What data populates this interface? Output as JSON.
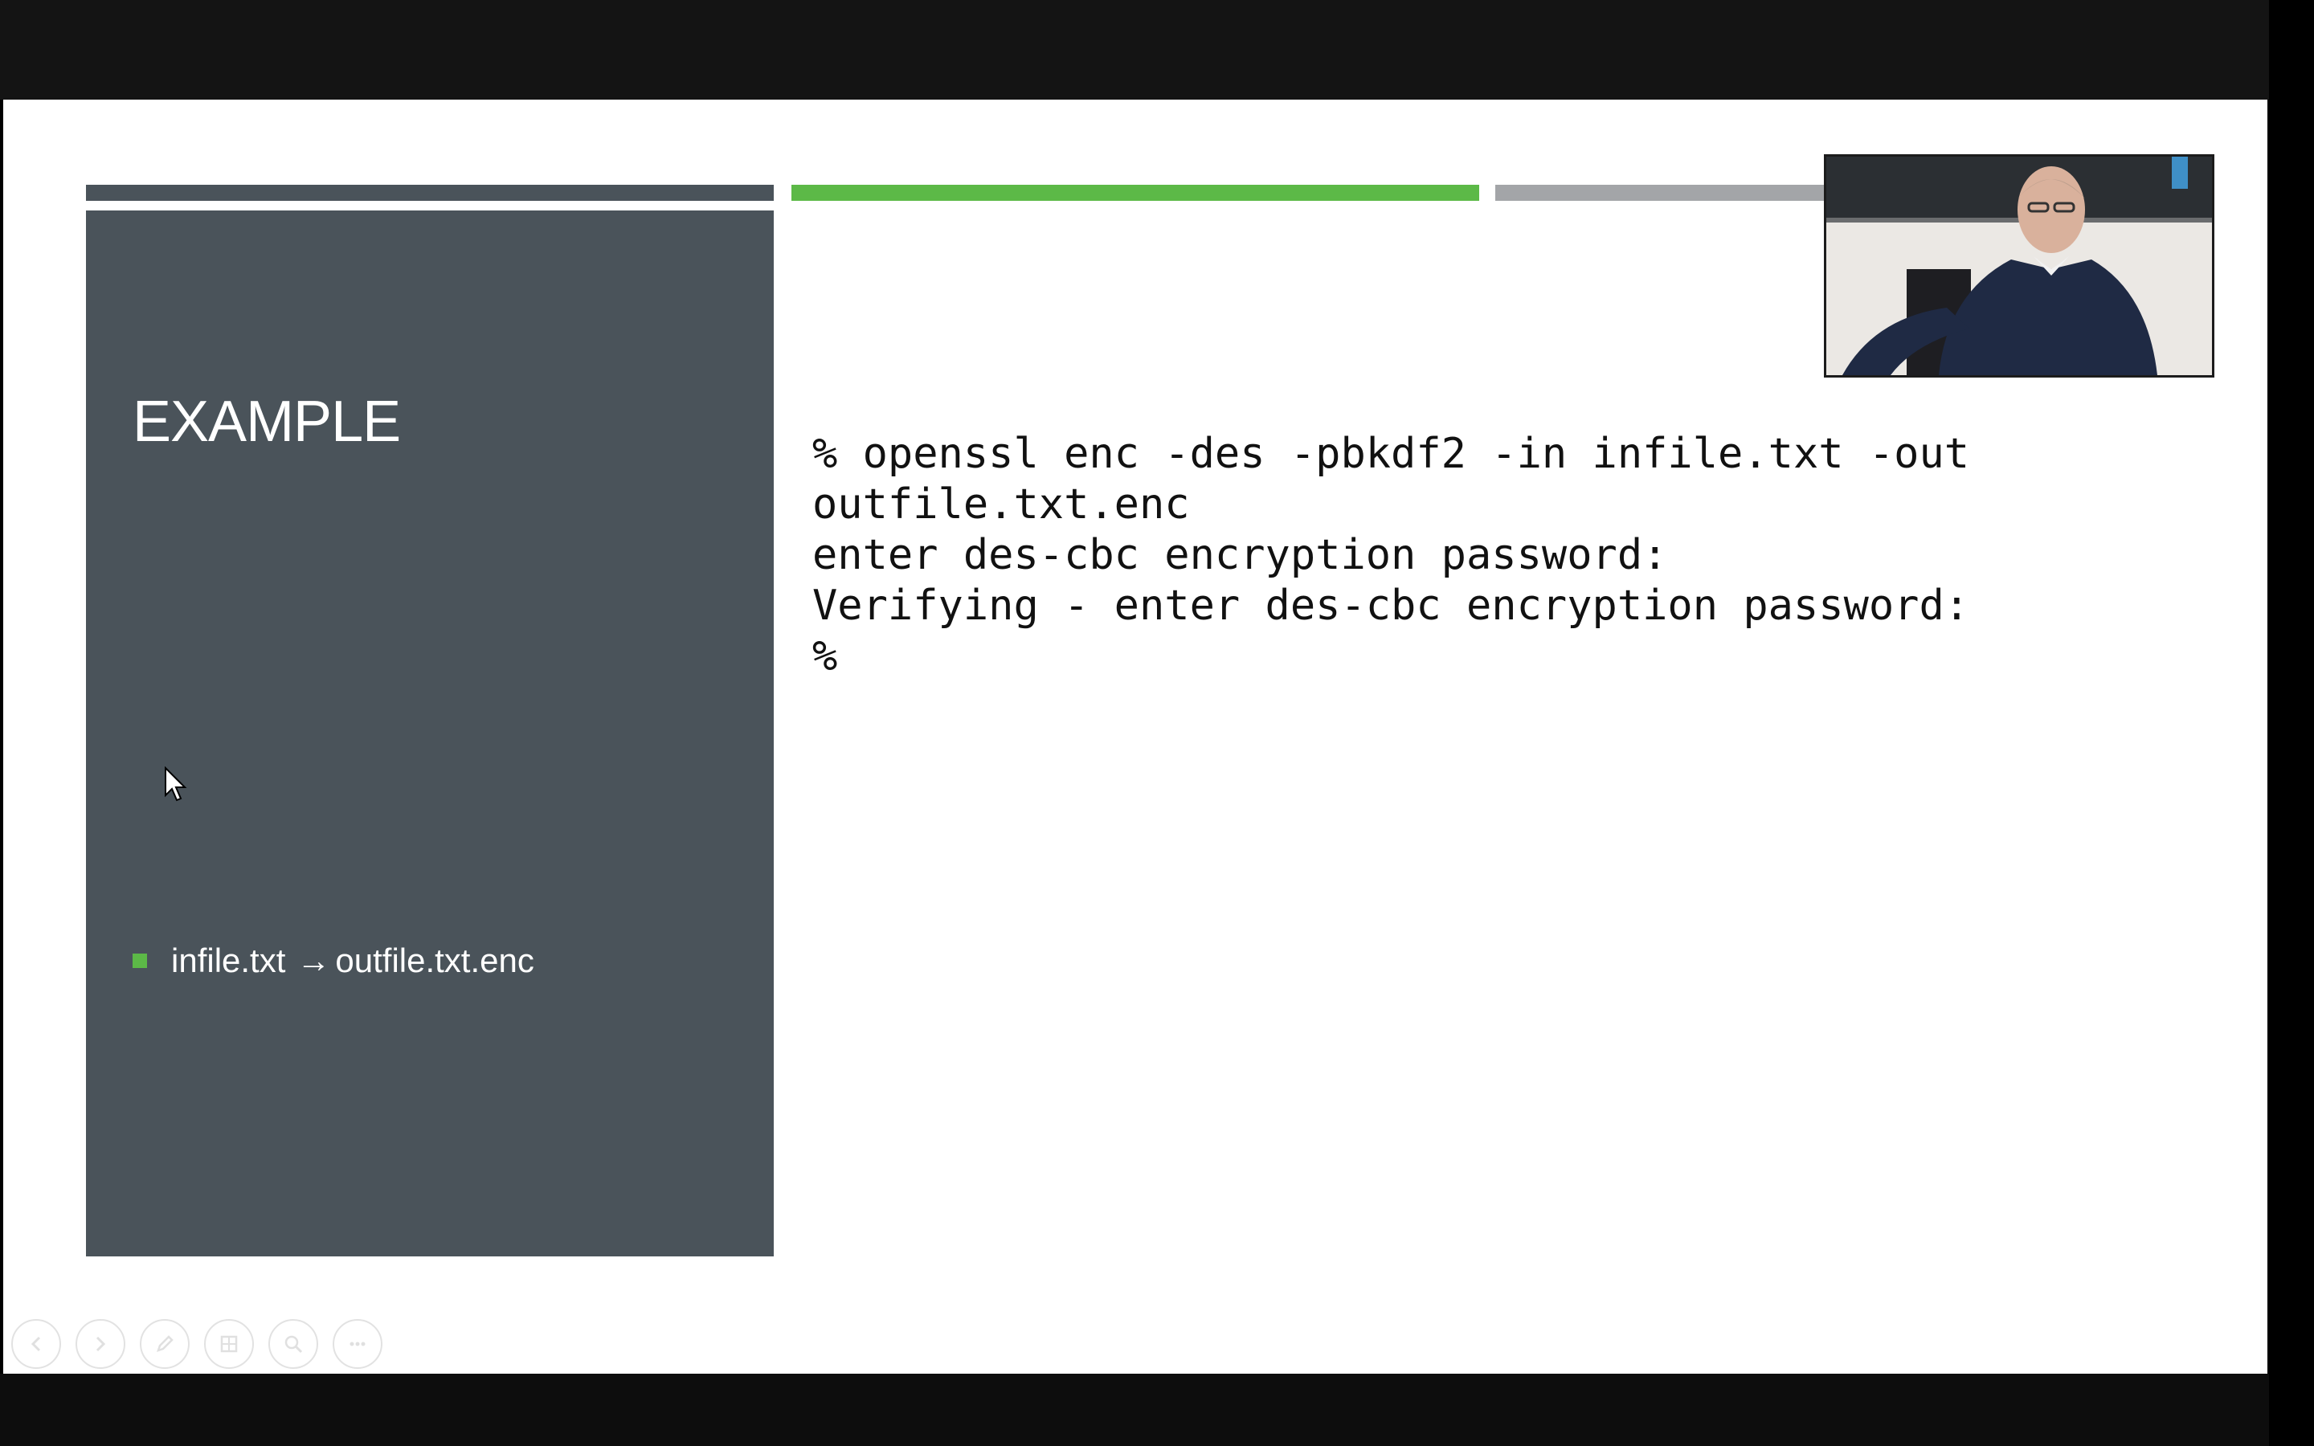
{
  "slide": {
    "title": "EXAMPLE",
    "bullet": {
      "left_text": "infile.txt",
      "arrow": "→",
      "right_text": "outfile.txt.enc"
    },
    "code_lines": [
      "% openssl enc -des -pbkdf2 -in infile.txt -out",
      "outfile.txt.enc",
      "enter des-cbc encryption password:",
      "Verifying - enter des-cbc encryption password:",
      "%"
    ]
  },
  "toolbar": {
    "buttons": [
      {
        "name": "previous-slide-button",
        "icon": "arrow-left-icon"
      },
      {
        "name": "next-slide-button",
        "icon": "arrow-right-icon"
      },
      {
        "name": "pen-tool-button",
        "icon": "pen-icon"
      },
      {
        "name": "see-all-slides-button",
        "icon": "slides-grid-icon"
      },
      {
        "name": "zoom-button",
        "icon": "magnifier-icon"
      },
      {
        "name": "more-options-button",
        "icon": "ellipsis-icon"
      }
    ]
  },
  "colors": {
    "panel": "#4a535a",
    "accent_green": "#5cb947",
    "accent_gray": "#a3a5a8",
    "slide_background": "#ffffff",
    "frame": "#000000"
  }
}
